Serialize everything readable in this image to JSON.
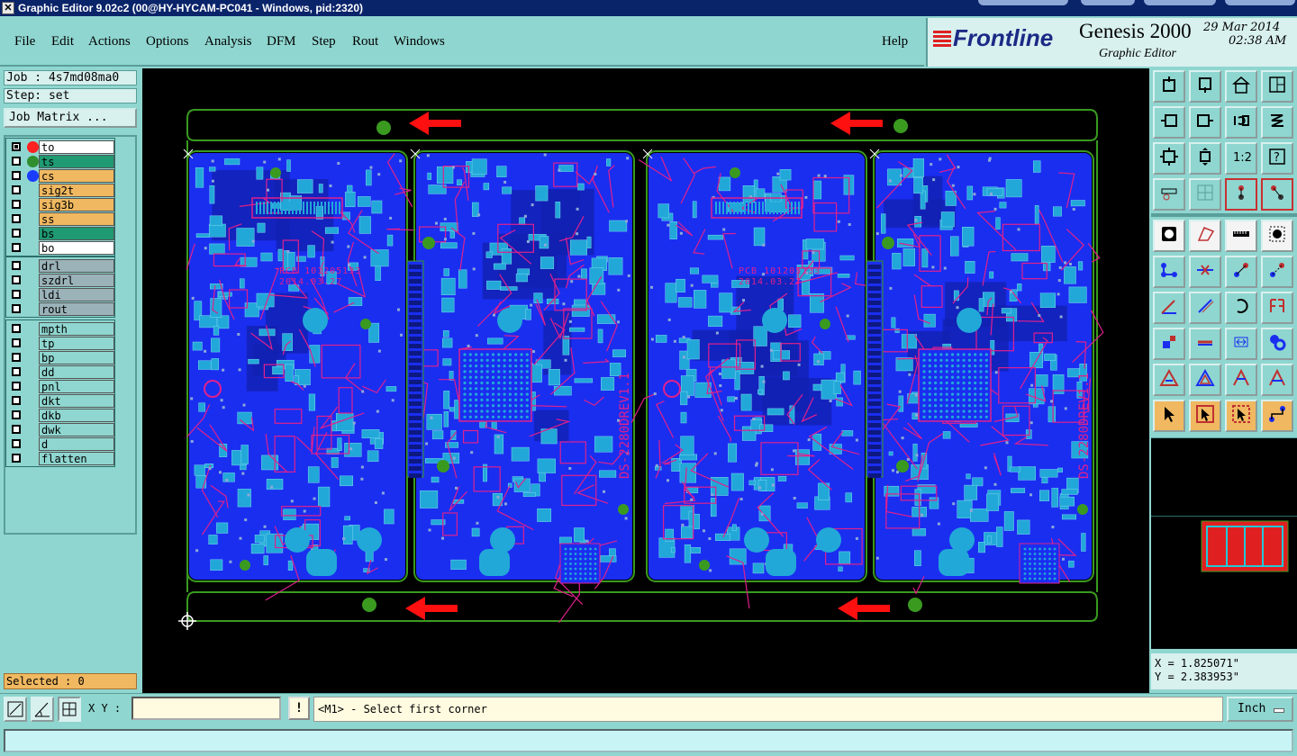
{
  "window": {
    "title": "Graphic Editor 9.02c2 (00@HY-HYCAM-PC041 - Windows, pid:2320)"
  },
  "menu": {
    "items": [
      "File",
      "Edit",
      "Actions",
      "Options",
      "Analysis",
      "DFM",
      "Step",
      "Rout",
      "Windows"
    ],
    "help": "Help"
  },
  "brand": {
    "logo": "Frontline",
    "product": "Genesis 2000",
    "subtitle": "Graphic Editor",
    "date": "29 Mar 2014",
    "time": "02:38 AM"
  },
  "left": {
    "job": "Job : 4s7md08ma0",
    "step": "Step: set",
    "job_matrix": "Job Matrix ...",
    "layers_group1": [
      {
        "name": "to",
        "bg": "#ffffff",
        "dot": "#ff2020"
      },
      {
        "name": "ts",
        "bg": "#1f9a72",
        "dot": "#2f8f2f"
      },
      {
        "name": "cs",
        "bg": "#f0b860",
        "dot": "#1a3cff"
      },
      {
        "name": "sig2t",
        "bg": "#f0b860",
        "dot": ""
      },
      {
        "name": "sig3b",
        "bg": "#f0b860",
        "dot": ""
      },
      {
        "name": "ss",
        "bg": "#f0b860",
        "dot": ""
      },
      {
        "name": "bs",
        "bg": "#1f9a72",
        "dot": ""
      },
      {
        "name": "bo",
        "bg": "#ffffff",
        "dot": ""
      }
    ],
    "layers_group2": [
      {
        "name": "drl",
        "bg": "#9ab2b8"
      },
      {
        "name": "szdrl",
        "bg": "#9ab2b8"
      },
      {
        "name": "ldi",
        "bg": "#9ab2b8"
      },
      {
        "name": "rout",
        "bg": "#9ab2b8"
      }
    ],
    "layers_group3": [
      {
        "name": "mpth",
        "bg": "#8fd6d0"
      },
      {
        "name": "tp",
        "bg": "#8fd6d0"
      },
      {
        "name": "bp",
        "bg": "#8fd6d0"
      },
      {
        "name": "dd",
        "bg": "#8fd6d0"
      },
      {
        "name": "pnl",
        "bg": "#8fd6d0"
      },
      {
        "name": "dkt",
        "bg": "#8fd6d0"
      },
      {
        "name": "dkb",
        "bg": "#8fd6d0"
      },
      {
        "name": "dwk",
        "bg": "#8fd6d0"
      },
      {
        "name": "d",
        "bg": "#8fd6d0"
      },
      {
        "name": "flatten",
        "bg": "#8fd6d0"
      }
    ],
    "selected": "Selected : 0"
  },
  "board": {
    "text_pcb": "PCB 101205133",
    "text_date": "2014.03.27",
    "text_ds": "DS-2280DREV1.1"
  },
  "toolbar": {
    "icons": [
      "snapshot-icon",
      "restore-icon",
      "home-icon",
      "window-icon",
      "pan-left-icon",
      "pan-right-icon",
      "zoom-previous-icon",
      "redraw-icon",
      "fit-icon",
      "zoom-home-icon",
      "one-to-one-icon",
      "help-icon",
      "measure-tool-icon",
      "grid-icon",
      "layers-red-icon",
      "layers-red-2-icon",
      "record-icon",
      "polygon-icon",
      "ruler-icon",
      "black-dot-icon",
      "link-nodes-icon",
      "cross-nodes-icon",
      "move-node-icon",
      "move-node-2-icon",
      "angle-icon",
      "diagonal-icon",
      "arc-icon",
      "flip-icon",
      "select-feature-icon",
      "line-icon",
      "resize-icon",
      "shapes-icon",
      "triangle-icon",
      "triangle-2-icon",
      "triangle-3-icon",
      "triangle-4-icon",
      "pointer-icon",
      "pointer-box-icon",
      "pointer-box-2-icon",
      "connect-icon"
    ]
  },
  "coords": {
    "x": "X = 1.825071\"",
    "y": "Y = 2.383953\""
  },
  "status": {
    "xy_label": "X Y :",
    "bang": "!",
    "prompt": "<M1> - Select first corner",
    "units": "Inch"
  },
  "colors": {
    "accent": "#8fd6d0",
    "blue": "#1a2ef0",
    "cyan": "#22a8d8",
    "magenta": "#e0208c",
    "green": "#3a9a20",
    "red": "#ff1010"
  }
}
